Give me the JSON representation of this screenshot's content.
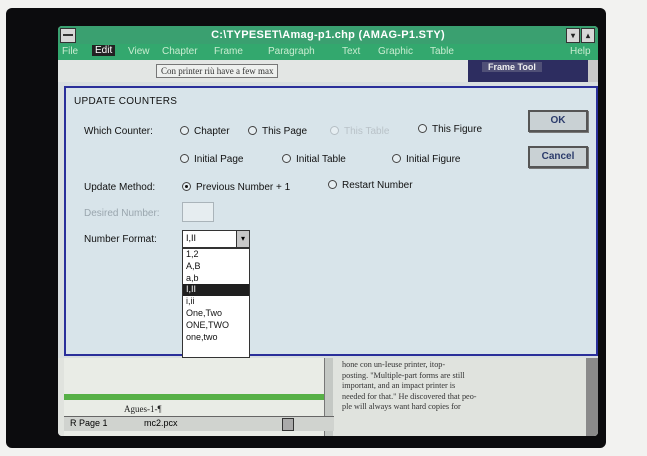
{
  "window": {
    "title": "C:\\TYPESET\\Amag-p1.chp  (AMAG-P1.STY)",
    "min_glyph": "▾",
    "max_glyph": "▴"
  },
  "menu": {
    "items": [
      "File",
      "Edit",
      "View",
      "Chapter",
      "Frame",
      "Paragraph",
      "Text",
      "Graphic",
      "Table",
      "Help"
    ],
    "selected": "Edit"
  },
  "document": {
    "top_line": "Con printer riù have a few max",
    "frame_panel_label": "Frame Tool"
  },
  "dialog": {
    "title": "UPDATE COUNTERS",
    "which_counter_label": "Which Counter:",
    "counters": {
      "chapter": "Chapter",
      "this_page": "This Page",
      "this_table": "This Table",
      "this_figure": "This Figure",
      "initial_page": "Initial Page",
      "initial_table": "Initial Table",
      "initial_figure": "Initial Figure"
    },
    "update_method_label": "Update Method:",
    "methods": {
      "previous": "Previous Number + 1",
      "restart": "Restart Number"
    },
    "desired_number_label": "Desired Number:",
    "number_format_label": "Number Format:",
    "number_format_value": "I,II",
    "combo_arrow": "▾",
    "formats": [
      "1,2",
      "A,B",
      "a,b",
      "I,II",
      "i,ii",
      "One,Two",
      "ONE,TWO",
      "one,two"
    ],
    "selected_format": "I,II",
    "ok_label": "OK",
    "cancel_label": "Cancel"
  },
  "body_text": {
    "left_caption": "Agues-1-¶",
    "right_lines": [
      "hone con un-Ieuse printer, itop-",
      "posting. \"Multiple-part forms are still",
      "important, and an impact printer is",
      "needed for that.\" He discovered that peo-",
      "ple will always want hard copies for"
    ]
  },
  "status": {
    "page": "R Page 1",
    "file": "mc2.pcx"
  }
}
